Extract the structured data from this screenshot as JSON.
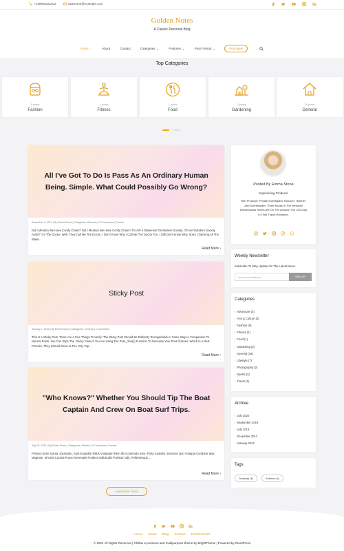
{
  "topbar": {
    "phone": "+449955221912",
    "email": "awesome@example.com",
    "social": [
      "facebook-icon",
      "twitter-icon",
      "youtube-icon",
      "instagram-icon",
      "linkedin-icon"
    ]
  },
  "site": {
    "title": "Golden Notes",
    "tagline": "A Classic Personal Blog"
  },
  "nav": {
    "items": [
      "Home",
      "About",
      "Contact",
      "Categories",
      "Features",
      "Post Format"
    ],
    "purchase": "Purchase!"
  },
  "top_categories": {
    "heading": "Top Categories",
    "items": [
      {
        "count": "5 posts",
        "name": "Fashion",
        "icon": "fashion-icon"
      },
      {
        "count": "1 posts",
        "name": "Fitness",
        "icon": "fitness-icon"
      },
      {
        "count": "1 posts",
        "name": "Food",
        "icon": "food-icon"
      },
      {
        "count": "2 posts",
        "name": "Gardening",
        "icon": "gardening-icon"
      },
      {
        "count": "19 posts",
        "name": "General",
        "icon": "home-icon"
      }
    ]
  },
  "posts": [
    {
      "title": "All I've Got To Do Is Pass As An Ordinary Human Being. Simple. What Could Possibly Go Wrong?",
      "meta": "December 3, 2017  |  By Emma Stone  |  Categories: General  |  10 Comments  |  Format:",
      "excerpt": "Did I Mention We Have Comfy Chairs? Did I Mention We Have Comfy Chairs? It's Art! A Statement On Modern Society, 'Oh Ain't Modern Society Awful?' I'm The Doctor. Well, They Call Me The Doctor. I Don't Know Why I Call Me The Doctor Too. I Still Don't Know Why. Sorry, Checking All The Water...",
      "more": "Read More"
    },
    {
      "title": "Sticky Post",
      "meta": "January 7, 2012  |  By Emma Stone  |  Categories: General  |  0 Comments",
      "excerpt": "This Is A Sticky Post. There Are A Few Things To Verify: The Sticky Post Should Be Distinctly Recognizable In Some Way In Comparison To Normal Posts. You Can Style The .Sticky Class If You Are Using The Post_class() Function To Generate Your Post Classes, Which Is A Best Practice. They Should Show At The Very Top...",
      "more": "Read More"
    },
    {
      "title": "\"Who Knows?\" Whether You Should Tip The Boat Captain And Crew On Boat Surf Trips.",
      "meta": "July 10, 2020  |  By Emma Stone  |  Categories: Fashion  |  0 Comments  |  Format:",
      "excerpt": "Pretium Enim Soluta, Explicabo, Sunt Expedita Tellus Voluptate! Rem Illo Commodo Irure, Porta Sodales. Eiusmod Quo Volutpat Curabitur Ipsa Magnam. Sint Est Lacinia Purus! Venenatis Porttitor Sollicitudin Pulvinar Odit, Pellentesque,...",
      "more": "Read More"
    }
  ],
  "load_more": "Load More Posts",
  "author": {
    "name": "Posted By Emma Stone",
    "role": "Supervising Producer",
    "bio": "Film Producer, Private Investigator, Bouncer, Teacher, And Screenwriter. Three Books In The Immortal Descendants Series Are On The Amazon Top 100 Lists In Time Travel Romance."
  },
  "newsletter": {
    "title": "Weekly Newsletter",
    "text": "Subscribe To Stay Update On The Latest News.",
    "placeholder": "Your email address",
    "button": "SIGN UP"
  },
  "categories": {
    "title": "Categories",
    "items": [
      "Adventure (3)",
      "Arts & Culture (4)",
      "Fashion (5)",
      "Fitness (1)",
      "Food (1)",
      "Gardening (2)",
      "General (19)",
      "Lifestyle (7)",
      "Photography (2)",
      "Sports (3)",
      "Travel (1)"
    ]
  },
  "archive": {
    "title": "Archive",
    "items": [
      "July 2020",
      "September 2019",
      "July 2019",
      "December 2017",
      "January 2013"
    ]
  },
  "tags": {
    "title": "Tags",
    "items": [
      "Dropcap (1)",
      "Science (1)"
    ]
  },
  "footer": {
    "nav": [
      "Home",
      "About",
      "Blog",
      "Contact",
      "PURCHASE!"
    ],
    "copyright": "© 2021 All Rights Reserved | Chillax a premium and multipurpose theme by BrightTheme | Powered by WordPress"
  },
  "colors": {
    "accent": "#e0a020",
    "background": "#f3f3f5"
  }
}
